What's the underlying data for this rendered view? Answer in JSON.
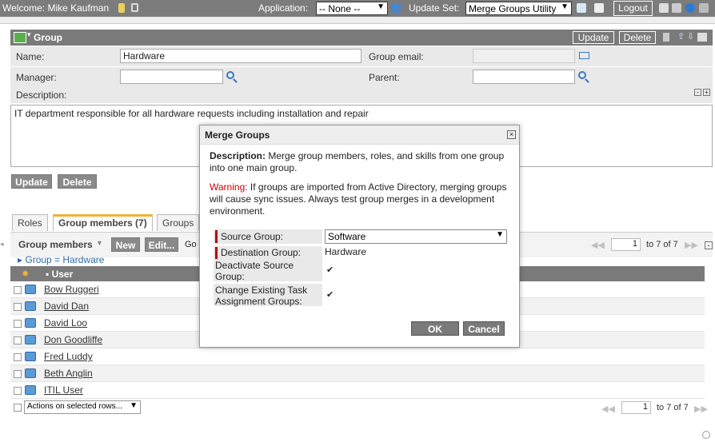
{
  "topbar": {
    "welcome": "Welcome: Mike Kaufman",
    "application_label": "Application:",
    "application_value": "-- None --",
    "update_set_label": "Update Set:",
    "update_set_value": "Merge Groups Utility",
    "logout": "Logout"
  },
  "form": {
    "title": "Group",
    "update": "Update",
    "delete": "Delete",
    "name_label": "Name:",
    "name_value": "Hardware",
    "email_label": "Group email:",
    "email_value": "",
    "manager_label": "Manager:",
    "manager_value": "",
    "parent_label": "Parent:",
    "parent_value": "",
    "description_label": "Description:",
    "description_value": "IT department responsible for all hardware requests including installation and repair",
    "bottom_update": "Update",
    "bottom_delete": "Delete"
  },
  "tabs": [
    "Roles",
    "Group members (7)",
    "Groups"
  ],
  "list": {
    "title": "Group members",
    "new": "New",
    "edit": "Edit...",
    "goto": "Go t",
    "breadcrumb": "Group = Hardware",
    "column_user": "User",
    "page_value": "1",
    "page_total": "to 7 of 7",
    "users": [
      "Bow Ruggeri",
      "David Dan",
      "David Loo",
      "Don Goodliffe",
      "Fred Luddy",
      "Beth Anglin",
      "ITIL User"
    ],
    "actions": "Actions on selected rows...",
    "bottom_page_value": "1",
    "bottom_page_total": "to 7 of 7"
  },
  "modal": {
    "title": "Merge Groups",
    "desc_label": "Description:",
    "desc_text": " Merge group members, roles, and skills from one group into one main group.",
    "warn_label": "Warning:",
    "warn_text": " If groups are imported from Active Directory, merging groups will cause sync issues. Always test group merges in a development environment.",
    "source_label": "Source Group:",
    "source_value": "Software",
    "dest_label": "Destination Group:",
    "dest_value": "Hardware",
    "deactivate_label": "Deactivate Source Group:",
    "deactivate_checked": true,
    "change_label": "Change Existing Task Assignment Groups:",
    "change_checked": true,
    "ok": "OK",
    "cancel": "Cancel"
  },
  "colors": {
    "header_gray": "#7a7a7a",
    "warning_red": "#cc0000",
    "tab_accent": "#f0b133",
    "link_blue": "#2e6aa8"
  }
}
